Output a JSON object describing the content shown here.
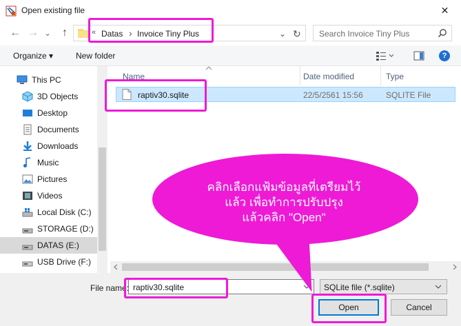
{
  "window": {
    "title": "Open existing file",
    "close_glyph": "✕"
  },
  "navigation": {
    "back_glyph": "←",
    "forward_glyph": "→",
    "recent_glyph": "⌄",
    "up_glyph": "↑"
  },
  "address": {
    "overflow_glyph": "«",
    "crumbs": [
      "Datas",
      "Invoice Tiny Plus"
    ],
    "separator_glyph": "›",
    "dropdown_glyph": "⌄",
    "refresh_glyph": "↻"
  },
  "search": {
    "placeholder": "Search Invoice Tiny Plus"
  },
  "toolbar": {
    "organize_label": "Organize ▾",
    "new_folder_label": "New folder",
    "help_glyph": "?"
  },
  "sidebar": {
    "items": [
      {
        "label": "This PC",
        "icon": "pc-icon"
      },
      {
        "label": "3D Objects",
        "icon": "cube-icon"
      },
      {
        "label": "Desktop",
        "icon": "desktop-icon"
      },
      {
        "label": "Documents",
        "icon": "documents-icon"
      },
      {
        "label": "Downloads",
        "icon": "download-icon"
      },
      {
        "label": "Music",
        "icon": "music-icon"
      },
      {
        "label": "Pictures",
        "icon": "pictures-icon"
      },
      {
        "label": "Videos",
        "icon": "videos-icon"
      },
      {
        "label": "Local Disk (C:)",
        "icon": "windows-drive-icon"
      },
      {
        "label": "STORAGE (D:)",
        "icon": "drive-icon"
      },
      {
        "label": "DATAS (E:)",
        "icon": "drive-icon",
        "selected": true
      },
      {
        "label": "USB Drive (F:)",
        "icon": "usb-drive-icon"
      }
    ]
  },
  "file_list": {
    "columns": [
      "Name",
      "Date modified",
      "Type"
    ],
    "rows": [
      {
        "name": "raptiv30.sqlite",
        "date": "22/5/2561 15:56",
        "type": "SQLITE File"
      }
    ]
  },
  "footer": {
    "file_name_label": "File name:",
    "file_name_value": "raptiv30.sqlite",
    "file_type_value": "SQLite file (*.sqlite)",
    "open_label": "Open",
    "cancel_label": "Cancel"
  },
  "callout": {
    "lines": [
      "คลิกเลือกแฟ้มข้อมูลที่เตรียมไว้",
      "แล้ว เพื่อทำการปรับปรุง",
      "แล้วคลิก \"Open\""
    ]
  },
  "colors": {
    "highlight": "#ee1ad6",
    "callout_fill": "#ee1ad6",
    "selection": "#cce8ff",
    "accent": "#0078d7"
  }
}
